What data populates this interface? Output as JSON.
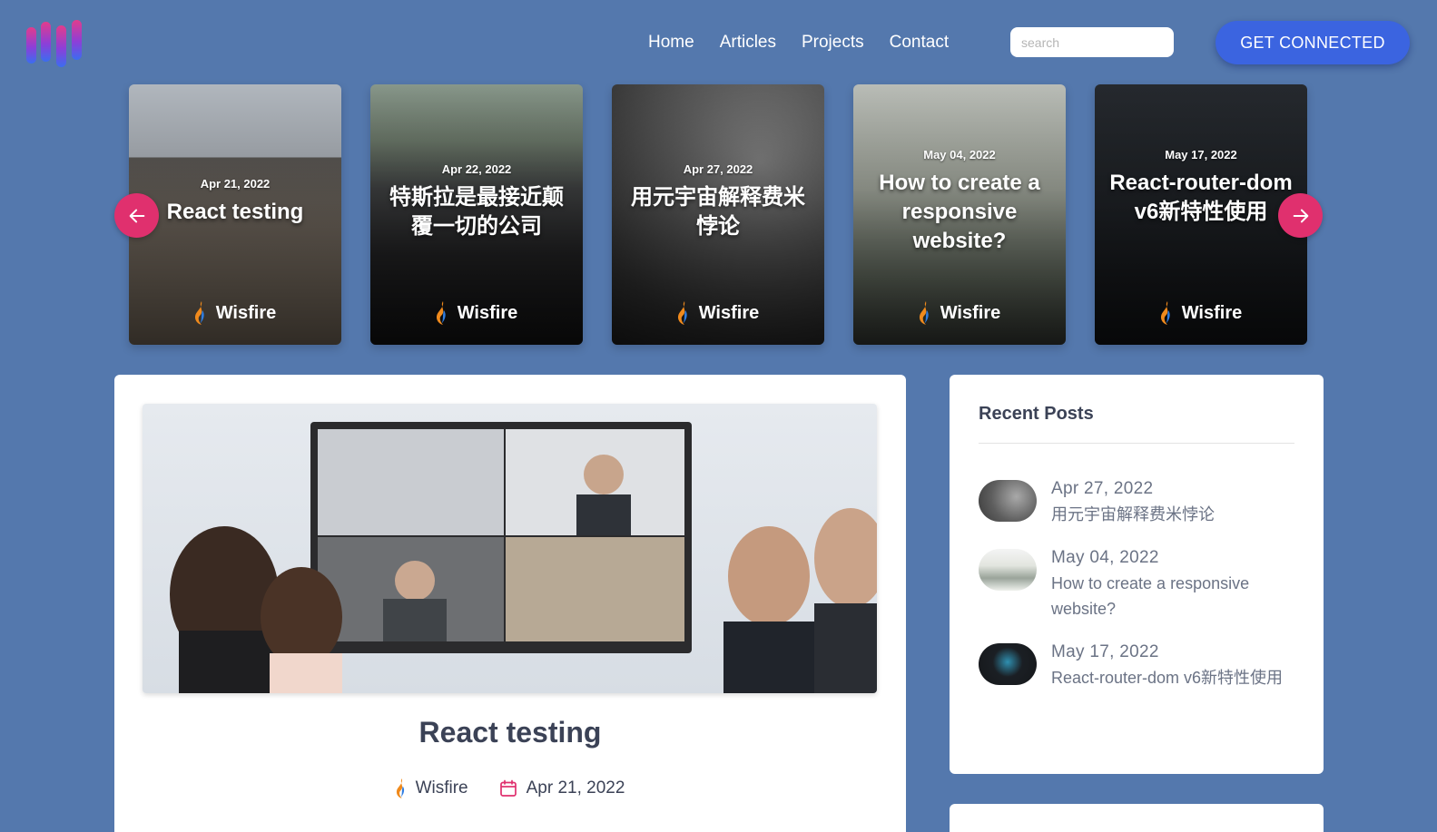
{
  "header": {
    "nav": [
      "Home",
      "Articles",
      "Projects",
      "Contact"
    ],
    "search_placeholder": "search",
    "cta_label": "GET CONNECTED"
  },
  "carousel": {
    "cards": [
      {
        "date": "Apr 21, 2022",
        "title": "React testing",
        "author": "Wisfire"
      },
      {
        "date": "Apr 22, 2022",
        "title": "特斯拉是最接近颠覆一切的公司",
        "author": "Wisfire"
      },
      {
        "date": "Apr 27, 2022",
        "title": "用元宇宙解释费米悖论",
        "author": "Wisfire"
      },
      {
        "date": "May 04, 2022",
        "title": "How to create a responsive website?",
        "author": "Wisfire"
      },
      {
        "date": "May 17, 2022",
        "title": "React-router-dom v6新特性使用",
        "author": "Wisfire"
      }
    ]
  },
  "post": {
    "title": "React testing",
    "author": "Wisfire",
    "date": "Apr 21, 2022"
  },
  "sidebar": {
    "heading": "Recent Posts",
    "items": [
      {
        "date": "Apr 27, 2022",
        "title": "用元宇宙解释费米悖论"
      },
      {
        "date": "May 04, 2022",
        "title": "How to create a responsive website?"
      },
      {
        "date": "May 17, 2022",
        "title": "React-router-dom v6新特性使用"
      }
    ]
  },
  "colors": {
    "background": "#5478ad",
    "accent": "#3b64e0",
    "arrow": "#e0306e"
  }
}
